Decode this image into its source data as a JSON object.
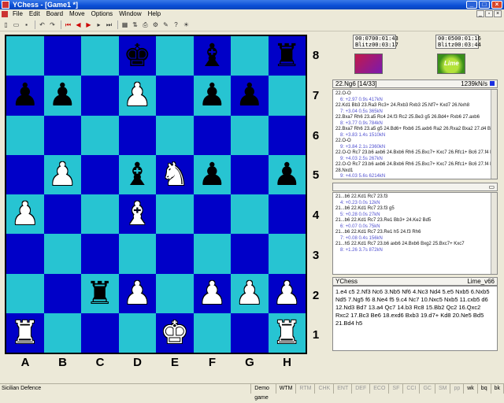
{
  "window": {
    "title": "YChess - [Game1 *]"
  },
  "menu": [
    "File",
    "Edit",
    "Board",
    "Move",
    "Options",
    "Window",
    "Help"
  ],
  "board": {
    "ranks": [
      "8",
      "7",
      "6",
      "5",
      "4",
      "3",
      "2",
      "1"
    ],
    "files": [
      "A",
      "B",
      "C",
      "D",
      "E",
      "F",
      "G",
      "H"
    ],
    "squares": [
      [
        "",
        "",
        "",
        "bk",
        "",
        "bb",
        "",
        "br"
      ],
      [
        "bp",
        "bp",
        "",
        "wp",
        "",
        "bp",
        "bp",
        ""
      ],
      [
        "",
        "",
        "",
        "",
        "",
        "",
        "",
        ""
      ],
      [
        "",
        "wp",
        "",
        "bb",
        "wn",
        "bp",
        "",
        "bp"
      ],
      [
        "wp",
        "",
        "",
        "wb",
        "",
        "",
        "",
        ""
      ],
      [
        "",
        "",
        "",
        "",
        "",
        "",
        "",
        ""
      ],
      [
        "",
        "",
        "br",
        "wp",
        "",
        "wp",
        "wp",
        "wp"
      ],
      [
        "wr",
        "",
        "",
        "",
        "wk",
        "",
        "",
        "wr"
      ]
    ]
  },
  "clocks": {
    "left": {
      "a": "00:07",
      "b": "00:01:43",
      "mode": "Blitz",
      "c": "00:03:17"
    },
    "right": {
      "a": "00:05",
      "b": "00:01:16",
      "mode": "Blitz",
      "c": "00:03:44"
    }
  },
  "avatar_right_label": "Lime",
  "analysis": {
    "header_left": "22.Ng6 [14/33]",
    "header_right": "1239kN/s",
    "lines": [
      {
        "type": "mv",
        "text": "22.O-O"
      },
      {
        "type": "eval",
        "text": "6: +2.97 0.9s 417kN"
      },
      {
        "type": "mv",
        "text": "22.Kd1 Bb3 23.Ra3 Rc3+ 24.Rxb3 Rxb3 25.Nf7+ Kxd7 26.Nxh8"
      },
      {
        "type": "eval",
        "text": "7: +3.04 0.5s 365kN"
      },
      {
        "type": "mv",
        "text": "22.Bxa7 Rh6 23.a5 Rc4 24.f3 Rc2 25.Be3 g5 26.Bd4+ Rxb6 27.axb6"
      },
      {
        "type": "eval",
        "text": "8: +3.77 0.9s 784kN"
      },
      {
        "type": "mv",
        "text": "22.Bxa7 Rh6 23.a5 g5 24.Bd6+ Rxb6 25.axb6 Ra2 26.Rxa2 Bxa2 27.d4 Bg7 28.h4"
      },
      {
        "type": "eval",
        "text": "8: +3.83 1.4s 1510kN"
      },
      {
        "type": "mv",
        "text": "22.O-O"
      },
      {
        "type": "eval",
        "text": "9: +3.84 2.1s 2360kN"
      },
      {
        "type": "mv",
        "text": "22.O-O Rc7 23.b6 axb6 24.Bxb6 Rh6 25.Bxc7+ Kxc7 26.Rfc1+ Bc6 27.f4 Rd6"
      },
      {
        "type": "eval",
        "text": "9: +4.03 2.5s 267kN"
      },
      {
        "type": "mv",
        "text": "22.O-O Rc7 23.b6 axb6 24.Bxb6 Rh6 25.Bxc7+ Kxc7 26.Rfc1+ Bc6 27.f4 Rd6"
      },
      {
        "type": "mv",
        "text": "28.Nxd1"
      },
      {
        "type": "eval",
        "text": "9: +4.03 5.6s 6214kN"
      }
    ]
  },
  "panel2": {
    "lines": [
      {
        "type": "mv",
        "text": "21...b6 22.Kd1 Rc7 23.f3"
      },
      {
        "type": "eval",
        "text": "4: +0.23 0.0s 12kN"
      },
      {
        "type": "mv",
        "text": "21...b6 22.Kd1 Rc7 23.f3 g5"
      },
      {
        "type": "eval",
        "text": "5: +0.28 0.0s 27kN"
      },
      {
        "type": "mv",
        "text": "21...b6 22.Kd1 Rc7 23.Re1 Bb3+ 24.Ke2 Bd5"
      },
      {
        "type": "eval",
        "text": "6: +0.07 0.0s 75kN"
      },
      {
        "type": "mv",
        "text": "21...b6 22.Kd1 Rc7 23.Re1 h5 24.f3 Rh6"
      },
      {
        "type": "eval",
        "text": "7: +0.08 0.4s 156kN"
      },
      {
        "type": "mv",
        "text": "21...h5 22.Kd1 Rc7 23.b6 axb6 24.Bxb6 Bxg2 25.Bxc7+ Kxc7"
      },
      {
        "type": "eval",
        "text": "8: +1.26 3.7s 872kN"
      }
    ]
  },
  "notation": {
    "white_player": "YChess",
    "black_player": "Lime_v66",
    "moves": "1.e4 c5 2.Nf3 Nc6 3.Nb5 Nf6 4.Nc3 Nd4 5.e5 Nxb5 6.Nxb5 Nd5 7.Ng5 f6 8.Ne4 f5 9.c4 Nc7 10.Nxc5 Nxb5 11.cxb5 d6 12.Nd3 Bd7 13.a4 Qc7 14.b3 Rc8 15.Bb2 Qc2 16.Qxc2 Rxc2 17.Bc3 Be6 18.exd6 Bxb3 19.d7+ Kd8 20.Ne5 Bd5 21.Bd4 h5"
  },
  "status": {
    "opening": "Sicilian Defence",
    "mode": "Demo game",
    "cells": [
      "WTM",
      "RTM",
      "CHK",
      "ENT",
      "DEF",
      "ECO",
      "SF",
      "CCI",
      "GC",
      "SM",
      "pp"
    ],
    "flags": [
      "wk",
      "bq",
      "bk"
    ]
  },
  "colors": {
    "dark_square": "#0000c8",
    "light_square": "#27c4d2"
  }
}
